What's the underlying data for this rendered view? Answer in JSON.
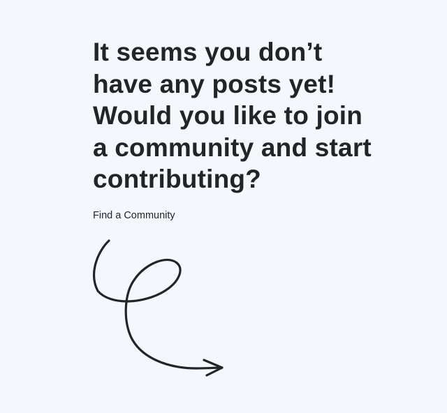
{
  "empty_state": {
    "headline_lines": [
      "It seems you don’t",
      "have any posts yet!",
      "Would you like to join",
      "a community and start",
      "contributing?"
    ],
    "cta_label": "Find a Community"
  },
  "colors": {
    "background": "#f4f8fd",
    "text": "#222428"
  },
  "icons": {
    "doodle": "curly-arrow-icon"
  }
}
